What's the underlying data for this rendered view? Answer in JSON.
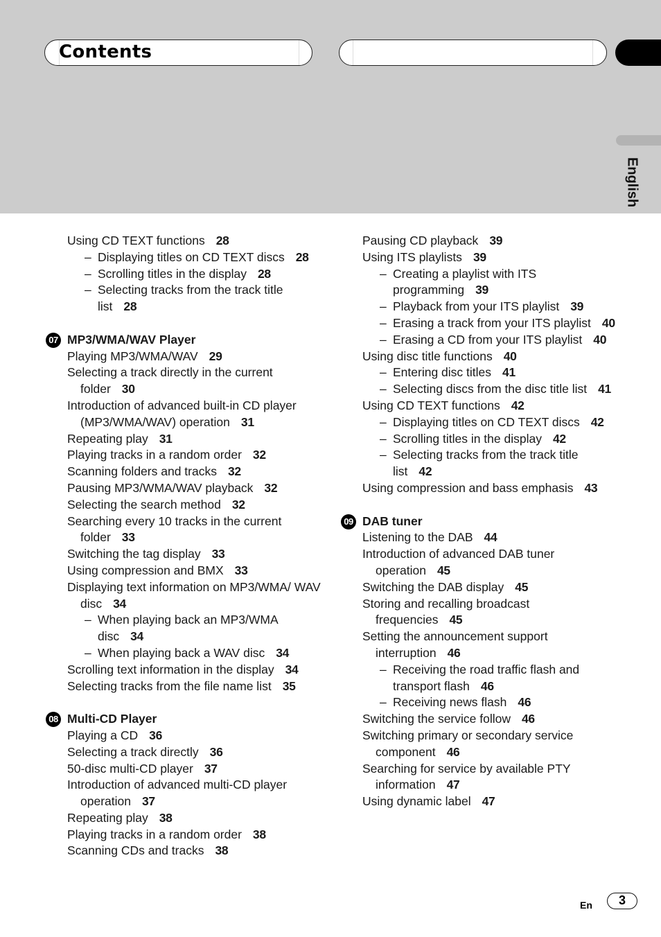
{
  "header": {
    "title": "Contents",
    "language_tab": "English"
  },
  "toc": {
    "left": [
      {
        "type": "entry",
        "level": 1,
        "text": "Using CD TEXT functions",
        "page": "28"
      },
      {
        "type": "entry",
        "level": 2,
        "text": "Displaying titles on CD TEXT discs",
        "page": "28"
      },
      {
        "type": "entry",
        "level": 2,
        "text": "Scrolling titles in the display",
        "page": "28"
      },
      {
        "type": "entry",
        "level": 2,
        "text": "Selecting tracks from the track title list",
        "page": "28"
      },
      {
        "type": "section",
        "number": "07",
        "title": "MP3/WMA/WAV Player"
      },
      {
        "type": "entry",
        "level": 1,
        "text": "Playing MP3/WMA/WAV",
        "page": "29"
      },
      {
        "type": "entry",
        "level": 1,
        "text": "Selecting a track directly in the current folder",
        "page": "30"
      },
      {
        "type": "entry",
        "level": 1,
        "text": "Introduction of advanced built-in CD player (MP3/WMA/WAV) operation",
        "page": "31"
      },
      {
        "type": "entry",
        "level": 1,
        "text": "Repeating play",
        "page": "31"
      },
      {
        "type": "entry",
        "level": 1,
        "text": "Playing tracks in a random order",
        "page": "32"
      },
      {
        "type": "entry",
        "level": 1,
        "text": "Scanning folders and tracks",
        "page": "32"
      },
      {
        "type": "entry",
        "level": 1,
        "text": "Pausing MP3/WMA/WAV playback",
        "page": "32"
      },
      {
        "type": "entry",
        "level": 1,
        "text": "Selecting the search method",
        "page": "32"
      },
      {
        "type": "entry",
        "level": 1,
        "text": "Searching every 10 tracks in the current folder",
        "page": "33"
      },
      {
        "type": "entry",
        "level": 1,
        "text": "Switching the tag display",
        "page": "33"
      },
      {
        "type": "entry",
        "level": 1,
        "text": "Using compression and BMX",
        "page": "33"
      },
      {
        "type": "entry",
        "level": 1,
        "text": "Displaying text information on MP3/WMA/ WAV disc",
        "page": "34"
      },
      {
        "type": "entry",
        "level": 2,
        "text": "When playing back an MP3/WMA disc",
        "page": "34"
      },
      {
        "type": "entry",
        "level": 2,
        "text": "When playing back a WAV disc",
        "page": "34"
      },
      {
        "type": "entry",
        "level": 1,
        "text": "Scrolling text information in the display",
        "page": "34"
      },
      {
        "type": "entry",
        "level": 1,
        "text": "Selecting tracks from the file name list",
        "page": "35"
      },
      {
        "type": "section",
        "number": "08",
        "title": "Multi-CD Player"
      },
      {
        "type": "entry",
        "level": 1,
        "text": "Playing a CD",
        "page": "36"
      },
      {
        "type": "entry",
        "level": 1,
        "text": "Selecting a track directly",
        "page": "36"
      },
      {
        "type": "entry",
        "level": 1,
        "text": "50-disc multi-CD player",
        "page": "37"
      },
      {
        "type": "entry",
        "level": 1,
        "text": "Introduction of advanced multi-CD player operation",
        "page": "37"
      },
      {
        "type": "entry",
        "level": 1,
        "text": "Repeating play",
        "page": "38"
      },
      {
        "type": "entry",
        "level": 1,
        "text": "Playing tracks in a random order",
        "page": "38"
      },
      {
        "type": "entry",
        "level": 1,
        "text": "Scanning CDs and tracks",
        "page": "38"
      }
    ],
    "right": [
      {
        "type": "entry",
        "level": 1,
        "text": "Pausing CD playback",
        "page": "39"
      },
      {
        "type": "entry",
        "level": 1,
        "text": "Using ITS playlists",
        "page": "39"
      },
      {
        "type": "entry",
        "level": 2,
        "text": "Creating a playlist with ITS programming",
        "page": "39"
      },
      {
        "type": "entry",
        "level": 2,
        "text": "Playback from your ITS playlist",
        "page": "39"
      },
      {
        "type": "entry",
        "level": 2,
        "text": "Erasing a track from your ITS playlist",
        "page": "40"
      },
      {
        "type": "entry",
        "level": 2,
        "text": "Erasing a CD from your ITS playlist",
        "page": "40"
      },
      {
        "type": "entry",
        "level": 1,
        "text": "Using disc title functions",
        "page": "40"
      },
      {
        "type": "entry",
        "level": 2,
        "text": "Entering disc titles",
        "page": "41"
      },
      {
        "type": "entry",
        "level": 2,
        "text": "Selecting discs from the disc title list",
        "page": "41"
      },
      {
        "type": "entry",
        "level": 1,
        "text": "Using CD TEXT functions",
        "page": "42"
      },
      {
        "type": "entry",
        "level": 2,
        "text": "Displaying titles on CD TEXT discs",
        "page": "42"
      },
      {
        "type": "entry",
        "level": 2,
        "text": "Scrolling titles in the display",
        "page": "42"
      },
      {
        "type": "entry",
        "level": 2,
        "text": "Selecting tracks from the track title list",
        "page": "42"
      },
      {
        "type": "entry",
        "level": 1,
        "text": "Using compression and bass emphasis",
        "page": "43"
      },
      {
        "type": "section",
        "number": "09",
        "title": "DAB tuner"
      },
      {
        "type": "entry",
        "level": 1,
        "text": "Listening to the DAB",
        "page": "44"
      },
      {
        "type": "entry",
        "level": 1,
        "text": "Introduction of advanced DAB tuner operation",
        "page": "45"
      },
      {
        "type": "entry",
        "level": 1,
        "text": "Switching the DAB display",
        "page": "45"
      },
      {
        "type": "entry",
        "level": 1,
        "text": "Storing and recalling broadcast frequencies",
        "page": "45"
      },
      {
        "type": "entry",
        "level": 1,
        "text": "Setting the announcement support interruption",
        "page": "46"
      },
      {
        "type": "entry",
        "level": 2,
        "text": "Receiving the road traffic flash and transport flash",
        "page": "46"
      },
      {
        "type": "entry",
        "level": 2,
        "text": "Receiving news flash",
        "page": "46"
      },
      {
        "type": "entry",
        "level": 1,
        "text": "Switching the service follow",
        "page": "46"
      },
      {
        "type": "entry",
        "level": 1,
        "text": "Switching primary or secondary service component",
        "page": "46"
      },
      {
        "type": "entry",
        "level": 1,
        "text": "Searching for service by available PTY information",
        "page": "47"
      },
      {
        "type": "entry",
        "level": 1,
        "text": "Using dynamic label",
        "page": "47"
      }
    ]
  },
  "footer": {
    "language_code": "En",
    "page_number": "3"
  }
}
